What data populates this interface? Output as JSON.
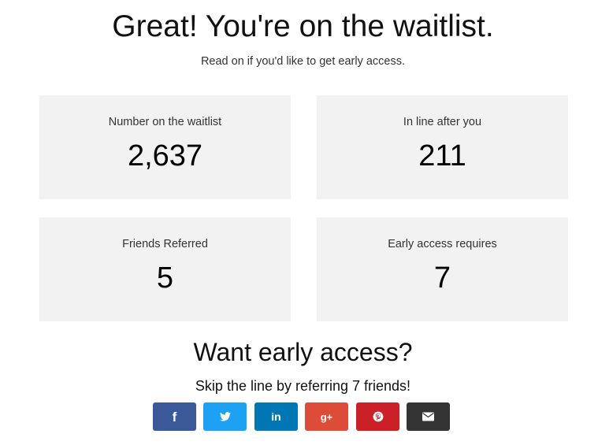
{
  "header": {
    "title": "Great! You're on the waitlist.",
    "subtitle": "Read on if you'd like to get early access."
  },
  "stats": [
    {
      "label": "Number on the waitlist",
      "value": "2,637"
    },
    {
      "label": "In line after you",
      "value": "211"
    },
    {
      "label": "Friends Referred",
      "value": "5"
    },
    {
      "label": "Early access requires",
      "value": "7"
    }
  ],
  "cta": {
    "title": "Want early access?",
    "subtitle": "Skip the line by referring 7 friends!"
  },
  "share_buttons": [
    {
      "icon": "facebook-icon",
      "glyph": "f",
      "color": "#3b5998"
    },
    {
      "icon": "twitter-icon",
      "glyph": "",
      "color": "#1da1f2"
    },
    {
      "icon": "linkedin-icon",
      "glyph": "in",
      "color": "#0077b5"
    },
    {
      "icon": "google-plus-icon",
      "glyph": "g+",
      "color": "#dd4b39"
    },
    {
      "icon": "pinterest-icon",
      "glyph": "",
      "color": "#cb2027"
    },
    {
      "icon": "email-icon",
      "glyph": "",
      "color": "#333333"
    }
  ],
  "colors": {
    "card_background": "#f2f2f2",
    "page_background": "#ffffff",
    "text": "#111111"
  }
}
